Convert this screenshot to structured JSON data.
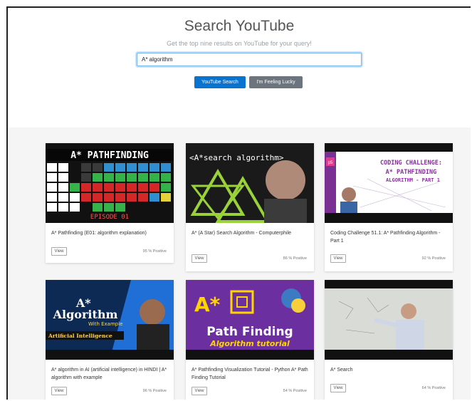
{
  "header": {
    "title": "Search YouTube",
    "subtitle": "Get the top nine results on YouTube for your query!"
  },
  "search": {
    "value": "A* algorithm",
    "search_button": "YouTube Search",
    "lucky_button": "I'm Feeling Lucky"
  },
  "results": [
    {
      "title": "A* Pathfinding (E01: algorithm explanation)",
      "view_label": "View",
      "positive": "95 % Positive",
      "thumb_text": "A* PATHFINDING",
      "thumb_sub": "EPISODE 01"
    },
    {
      "title": "A* (A Star) Search Algorithm - Computerphile",
      "view_label": "View",
      "positive": "86 % Positive",
      "thumb_text": "<A*search algorithm>"
    },
    {
      "title": "Coding Challenge 51.1: A* Pathfinding Algorithm - Part 1",
      "view_label": "View",
      "positive": "92 % Positive",
      "thumb_text": "CODING CHALLENGE: A* PATHFINDING ALGORITHM - PART 1",
      "thumb_badge": "p5"
    },
    {
      "title": "A* algorithm in AI (artificial intelligence) in HINDI | A* algorithm with example",
      "view_label": "View",
      "positive": "96 % Positive",
      "thumb_text": "A* Algorithm",
      "thumb_sub": "With Example",
      "thumb_band": "Artificial Intelligence"
    },
    {
      "title": "A* Pathfinding Visualization Tutorial - Python A* Path Finding Tutorial",
      "view_label": "View",
      "positive": "54 % Positive",
      "thumb_text": "Path Finding",
      "thumb_sub": "Algorithm tutorial"
    },
    {
      "title": "A* Search",
      "view_label": "View",
      "positive": "64 % Positive"
    }
  ],
  "colors": {
    "primary": "#0a73cf",
    "secondary": "#6c757d",
    "background": "#f5f5f5"
  }
}
